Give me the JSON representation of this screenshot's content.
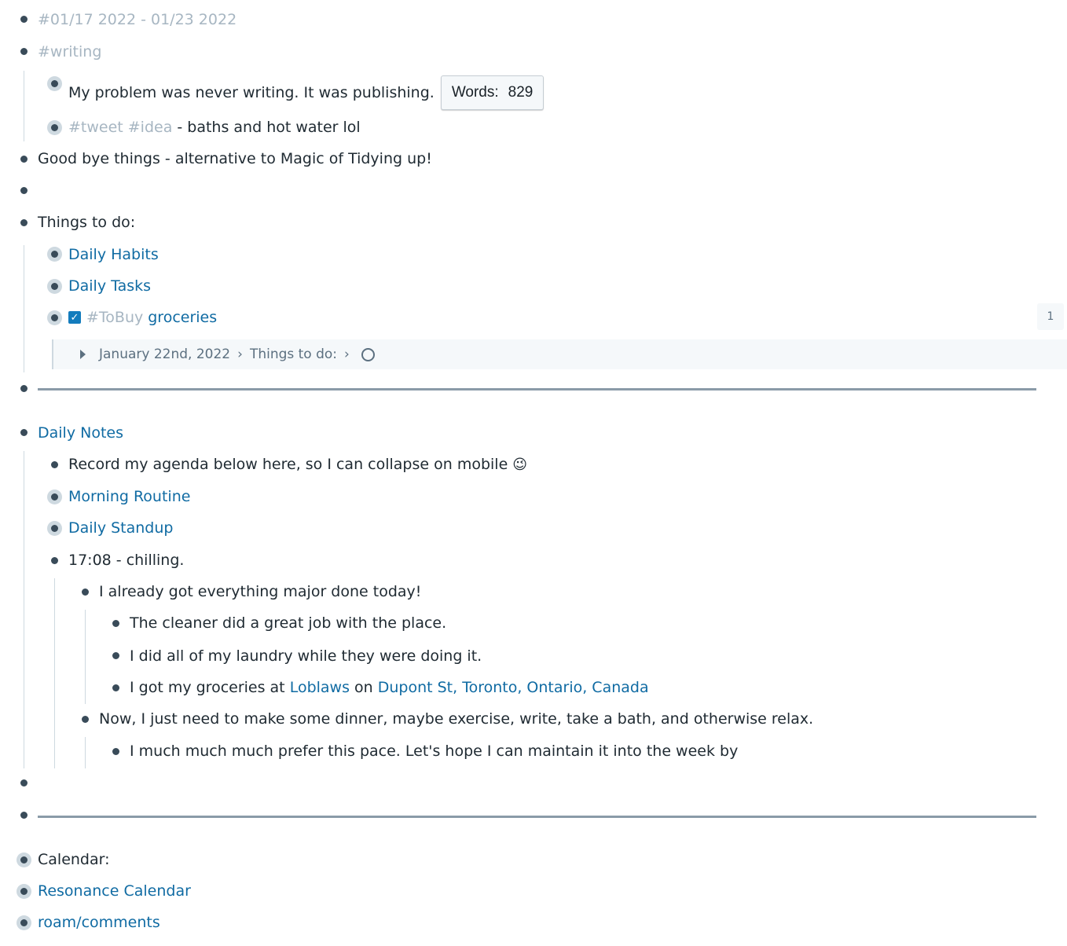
{
  "block1": {
    "text": "#01/17 2022 - 01/23 2022"
  },
  "block2": {
    "tag": "#writing",
    "children": {
      "c1_text": "My problem was never writing. It was publishing.",
      "c1_words_label": "Words:",
      "c1_words_count": "829",
      "c2_tag1": "#tweet",
      "c2_tag2": "#idea",
      "c2_text": " - baths and hot water lol"
    }
  },
  "block3": {
    "text": "Good bye things - alternative to Magic of Tidying up!"
  },
  "block5": {
    "text": "Things to do:",
    "children": {
      "daily_habits": "Daily Habits",
      "daily_tasks": "Daily Tasks",
      "tobuy_tag": "#ToBuy",
      "groceries": "groceries",
      "checkbox_checked": true,
      "ref_count": "1"
    },
    "reference": {
      "crumb1": "January 22nd, 2022",
      "sep": "›",
      "crumb2": "Things to do:"
    }
  },
  "block7": {
    "title": "Daily Notes",
    "children": {
      "record": "Record my agenda below here, so I can collapse on mobile",
      "record_emoji": "😉",
      "morning_routine": "Morning Routine",
      "daily_standup": "Daily Standup",
      "time_entry": "17:08 - chilling.",
      "sub1": {
        "text": "I already got everything major done today!",
        "items": {
          "i1": "The cleaner did a great job with the place.",
          "i2": "I did all of my laundry while they were doing it.",
          "i3_pre": "I got my groceries at ",
          "i3_link1": "Loblaws",
          "i3_mid": " on ",
          "i3_link2": "Dupont St, Toronto, Ontario, Canada"
        }
      },
      "sub2": {
        "text": "Now, I just need to make some dinner, maybe exercise, write, take a bath, and otherwise relax.",
        "items": {
          "i1": "I much much much prefer this pace. Let's hope I can maintain it into the week by"
        }
      }
    }
  },
  "block10": {
    "text": "Calendar:"
  },
  "block11": {
    "text": "Resonance Calendar"
  },
  "block12": {
    "text": "roam/comments"
  },
  "colors": {
    "link": "#106ba3",
    "tag": "#a7b6c2",
    "text": "#202b33",
    "bullet": "#394b59",
    "rule": "#8a9ba8",
    "checkbox": "#137cbd"
  }
}
